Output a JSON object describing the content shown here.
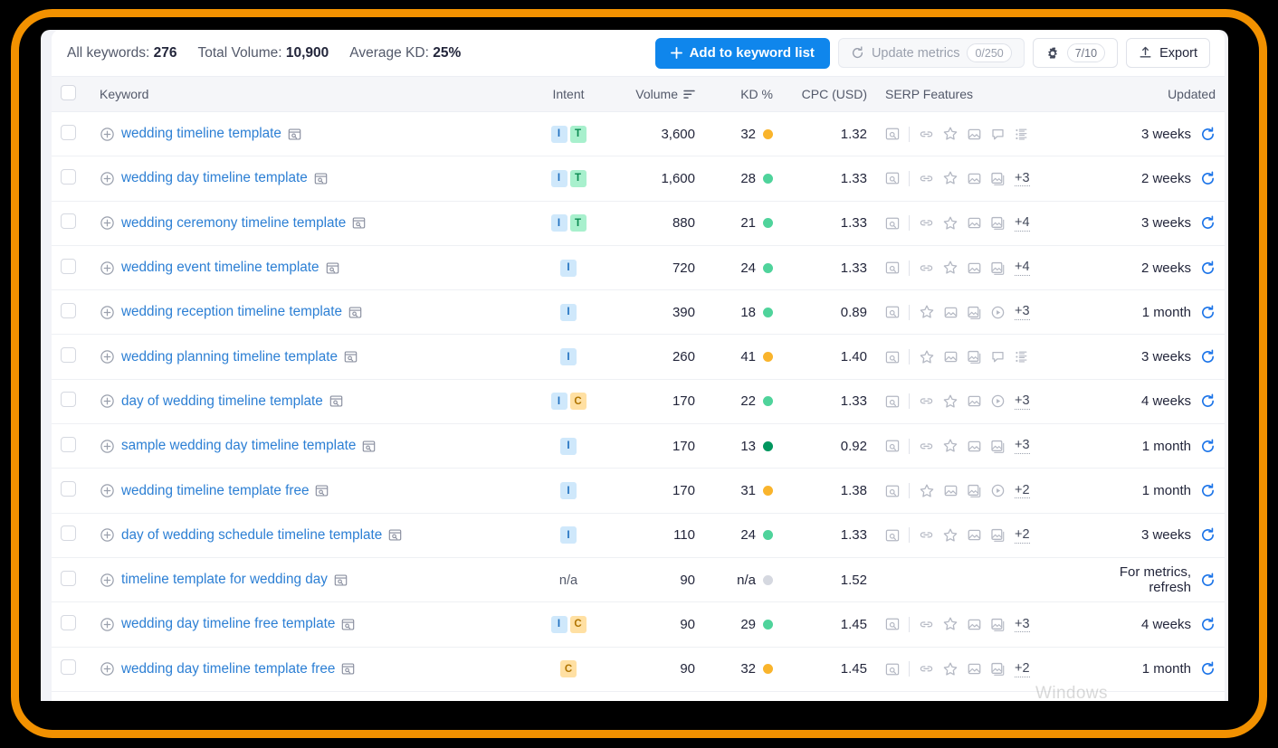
{
  "toolbar": {
    "all_keywords_label": "All keywords:",
    "all_keywords_value": "276",
    "total_volume_label": "Total Volume:",
    "total_volume_value": "10,900",
    "average_kd_label": "Average KD:",
    "average_kd_value": "25%",
    "add_button": "Add to keyword list",
    "add_button_plus": "+",
    "update_metrics": "Update metrics",
    "update_metrics_count": "0/250",
    "settings_count": "7/10",
    "export": "Export"
  },
  "columns": {
    "keyword": "Keyword",
    "intent": "Intent",
    "volume": "Volume",
    "kd": "KD %",
    "cpc": "CPC (USD)",
    "serp": "SERP Features",
    "updated": "Updated"
  },
  "colors": {
    "frame": "#F29100",
    "primary": "#0f86ec",
    "link": "#2c7fd4",
    "kd_easy": "#4FD39B",
    "kd_very_easy": "#00965E",
    "kd_medium": "#F9B42C",
    "kd_na": "#d5d8e0",
    "badge_informational": "#cfe8fb",
    "badge_transactional": "#a8f0cd",
    "badge_commercial": "#ffe0a3"
  },
  "watermark": "Windows",
  "rows": [
    {
      "keyword": "wedding timeline template",
      "intent": [
        "I",
        "T"
      ],
      "volume": "3,600",
      "kd": "32",
      "kd_color": "#F9B42C",
      "cpc": "1.32",
      "serp": [
        "sitelinks",
        "reviews",
        "image",
        "people-also-ask",
        "list"
      ],
      "serp_more": "",
      "updated": "3 weeks"
    },
    {
      "keyword": "wedding day timeline template",
      "intent": [
        "I",
        "T"
      ],
      "volume": "1,600",
      "kd": "28",
      "kd_color": "#4FD39B",
      "cpc": "1.33",
      "serp": [
        "sitelinks",
        "reviews",
        "image",
        "image-pack"
      ],
      "serp_more": "+3",
      "updated": "2 weeks"
    },
    {
      "keyword": "wedding ceremony timeline template",
      "intent": [
        "I",
        "T"
      ],
      "volume": "880",
      "kd": "21",
      "kd_color": "#4FD39B",
      "cpc": "1.33",
      "serp": [
        "sitelinks",
        "reviews",
        "image",
        "image-pack"
      ],
      "serp_more": "+4",
      "updated": "3 weeks"
    },
    {
      "keyword": "wedding event timeline template",
      "intent": [
        "I"
      ],
      "volume": "720",
      "kd": "24",
      "kd_color": "#4FD39B",
      "cpc": "1.33",
      "serp": [
        "sitelinks",
        "reviews",
        "image",
        "image-pack"
      ],
      "serp_more": "+4",
      "updated": "2 weeks"
    },
    {
      "keyword": "wedding reception timeline template",
      "intent": [
        "I"
      ],
      "volume": "390",
      "kd": "18",
      "kd_color": "#4FD39B",
      "cpc": "0.89",
      "serp": [
        "reviews",
        "image",
        "image-pack",
        "video"
      ],
      "serp_more": "+3",
      "updated": "1 month"
    },
    {
      "keyword": "wedding planning timeline template",
      "intent": [
        "I"
      ],
      "volume": "260",
      "kd": "41",
      "kd_color": "#F9B42C",
      "cpc": "1.40",
      "serp": [
        "reviews",
        "image",
        "image-pack",
        "people-also-ask",
        "list"
      ],
      "serp_more": "",
      "updated": "3 weeks"
    },
    {
      "keyword": "day of wedding timeline template",
      "intent": [
        "I",
        "C"
      ],
      "volume": "170",
      "kd": "22",
      "kd_color": "#4FD39B",
      "cpc": "1.33",
      "serp": [
        "sitelinks",
        "reviews",
        "image",
        "video"
      ],
      "serp_more": "+3",
      "updated": "4 weeks"
    },
    {
      "keyword": "sample wedding day timeline template",
      "intent": [
        "I"
      ],
      "volume": "170",
      "kd": "13",
      "kd_color": "#00965E",
      "cpc": "0.92",
      "serp": [
        "sitelinks",
        "reviews",
        "image",
        "image-pack"
      ],
      "serp_more": "+3",
      "updated": "1 month"
    },
    {
      "keyword": "wedding timeline template free",
      "intent": [
        "I"
      ],
      "volume": "170",
      "kd": "31",
      "kd_color": "#F9B42C",
      "cpc": "1.38",
      "serp": [
        "reviews",
        "image",
        "image-pack",
        "video"
      ],
      "serp_more": "+2",
      "updated": "1 month"
    },
    {
      "keyword": "day of wedding schedule timeline template",
      "intent": [
        "I"
      ],
      "volume": "110",
      "kd": "24",
      "kd_color": "#4FD39B",
      "cpc": "1.33",
      "serp": [
        "sitelinks",
        "reviews",
        "image",
        "image-pack"
      ],
      "serp_more": "+2",
      "updated": "3 weeks"
    },
    {
      "keyword": "timeline template for wedding day",
      "intent": [],
      "intent_na": "n/a",
      "volume": "90",
      "kd": "n/a",
      "kd_color": "#d5d8e0",
      "cpc": "1.52",
      "serp": [],
      "serp_more": "",
      "updated": "For metrics, refresh"
    },
    {
      "keyword": "wedding day timeline free template",
      "intent": [
        "I",
        "C"
      ],
      "volume": "90",
      "kd": "29",
      "kd_color": "#4FD39B",
      "cpc": "1.45",
      "serp": [
        "sitelinks",
        "reviews",
        "image",
        "image-pack"
      ],
      "serp_more": "+3",
      "updated": "4 weeks"
    },
    {
      "keyword": "wedding day timeline template free",
      "intent": [
        "C"
      ],
      "volume": "90",
      "kd": "32",
      "kd_color": "#F9B42C",
      "cpc": "1.45",
      "serp": [
        "sitelinks",
        "reviews",
        "image",
        "image-pack"
      ],
      "serp_more": "+2",
      "updated": "1 month"
    }
  ]
}
